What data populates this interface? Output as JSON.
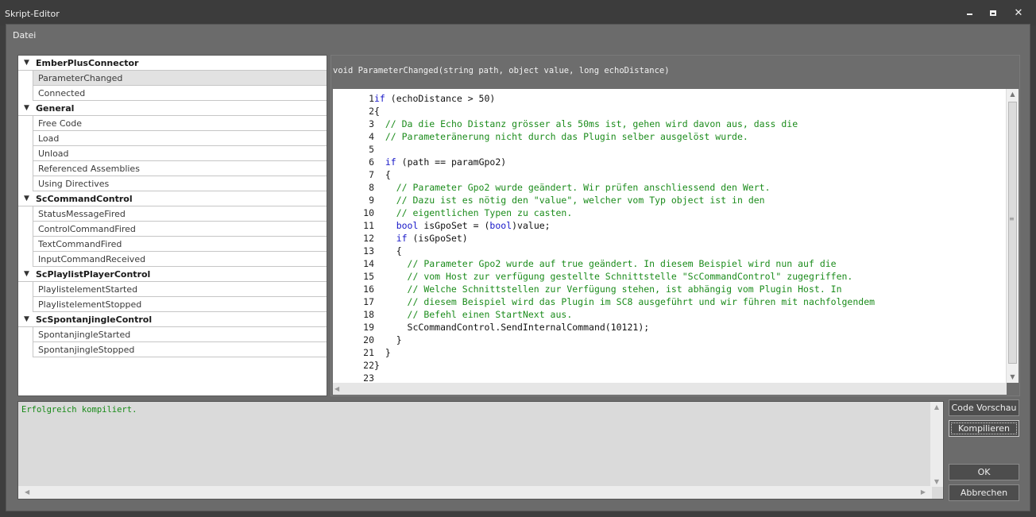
{
  "window": {
    "title": "Skript-Editor"
  },
  "menu": {
    "file_label": "Datei"
  },
  "tree": {
    "groups": [
      {
        "name": "EmberPlusConnector",
        "items": [
          "ParameterChanged",
          "Connected"
        ]
      },
      {
        "name": "General",
        "items": [
          "Free Code",
          "Load",
          "Unload",
          "Referenced Assemblies",
          "Using Directives"
        ]
      },
      {
        "name": "ScCommandControl",
        "items": [
          "StatusMessageFired",
          "ControlCommandFired",
          "TextCommandFired",
          "InputCommandReceived"
        ]
      },
      {
        "name": "ScPlaylistPlayerControl",
        "items": [
          "PlaylistelementStarted",
          "PlaylistelementStopped"
        ]
      },
      {
        "name": "ScSpontanjingleControl",
        "items": [
          "SpontanjingleStarted",
          "SpontanjingleStopped"
        ]
      }
    ],
    "selected_item": "ParameterChanged"
  },
  "editor": {
    "signature": "void ParameterChanged(string path, object value, long echoDistance)",
    "lines": [
      {
        "n": "1",
        "text": "if (echoDistance > 50)"
      },
      {
        "n": "2",
        "text": "{"
      },
      {
        "n": "3",
        "text": "  // Da die Echo Distanz grösser als 50ms ist, gehen wird davon aus, dass die"
      },
      {
        "n": "4",
        "text": "  // Parameteränerung nicht durch das Plugin selber ausgelöst wurde."
      },
      {
        "n": "5",
        "text": ""
      },
      {
        "n": "6",
        "text": "  if (path == paramGpo2)"
      },
      {
        "n": "7",
        "text": "  {"
      },
      {
        "n": "8",
        "text": "    // Parameter Gpo2 wurde geändert. Wir prüfen anschliessend den Wert."
      },
      {
        "n": "9",
        "text": "    // Dazu ist es nötig den \"value\", welcher vom Typ object ist in den"
      },
      {
        "n": "10",
        "text": "    // eigentlichen Typen zu casten."
      },
      {
        "n": "11",
        "text": "    bool isGpoSet = (bool)value;"
      },
      {
        "n": "12",
        "text": "    if (isGpoSet)"
      },
      {
        "n": "13",
        "text": "    {"
      },
      {
        "n": "14",
        "text": "      // Parameter Gpo2 wurde auf true geändert. In diesem Beispiel wird nun auf die"
      },
      {
        "n": "15",
        "text": "      // vom Host zur verfügung gestellte Schnittstelle \"ScCommandControl\" zugegriffen."
      },
      {
        "n": "16",
        "text": "      // Welche Schnittstellen zur Verfügung stehen, ist abhängig vom Plugin Host. In"
      },
      {
        "n": "17",
        "text": "      // diesem Beispiel wird das Plugin im SC8 ausgeführt und wir führen mit nachfolgendem"
      },
      {
        "n": "18",
        "text": "      // Befehl einen StartNext aus."
      },
      {
        "n": "19",
        "text": "      ScCommandControl.SendInternalCommand(10121);"
      },
      {
        "n": "20",
        "text": "    }"
      },
      {
        "n": "21",
        "text": "  }"
      },
      {
        "n": "22",
        "text": "}"
      },
      {
        "n": "23",
        "text": ""
      }
    ]
  },
  "output": {
    "message": "Erfolgreich kompiliert."
  },
  "buttons": {
    "preview": "Code Vorschau",
    "compile": "Kompilieren",
    "ok": "OK",
    "cancel": "Abbrechen"
  },
  "colors": {
    "comment": "#1c8c1c",
    "keyword": "#1818c8",
    "success": "#178a17"
  }
}
